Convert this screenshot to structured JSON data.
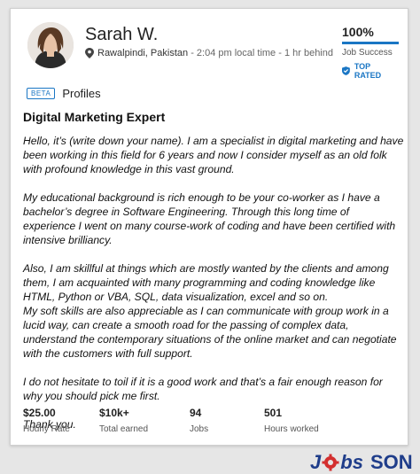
{
  "profile": {
    "name": "Sarah W.",
    "location": "Rawalpindi, Pakistan",
    "local_time": "- 2:04 pm local time - 1 hr behind",
    "job_success_pct": "100%",
    "job_success_label": "Job Success",
    "top_rated": "TOP RATED"
  },
  "tabs": {
    "beta": "BETA",
    "profiles": "Profiles"
  },
  "headline": "Digital Marketing Expert",
  "description": [
    "Hello, it’s (write down your name). I am a specialist in digital marketing and have been working in this field for 6 years and now I consider myself as an old folk with profound knowledge in this vast ground.",
    "My educational background is rich enough to be your co-worker as I have a bachelor’s degree in Software Engineering. Through this long time of experience I went on many course-work of coding and have been certified with intensive brilliancy.",
    "Also, I am skillful at things which are mostly wanted by the clients and among them, I am acquainted with many programming and coding knowledge like HTML, Python or VBA, SQL, data visualization, excel and so on.",
    "My soft skills are also appreciable as I can communicate with group work in a lucid way, can create a smooth road for the passing of complex data, understand the contemporary situations of the online market and can negotiate with the customers with full support.",
    "I do not hesitate to toil if it is a good work and that’s a fair enough reason for why you should pick me first.",
    "Thank you."
  ],
  "stats": [
    {
      "value": "$25.00",
      "label": "Hourly Rate"
    },
    {
      "value": "$10k+",
      "label": "Total earned"
    },
    {
      "value": "94",
      "label": "Jobs"
    },
    {
      "value": "501",
      "label": "Hours worked"
    }
  ],
  "watermark": {
    "j": "J",
    "bs": "bs",
    "son": "SON"
  },
  "colors": {
    "accent": "#1a76c4",
    "watermark": "#1f3d8a"
  }
}
